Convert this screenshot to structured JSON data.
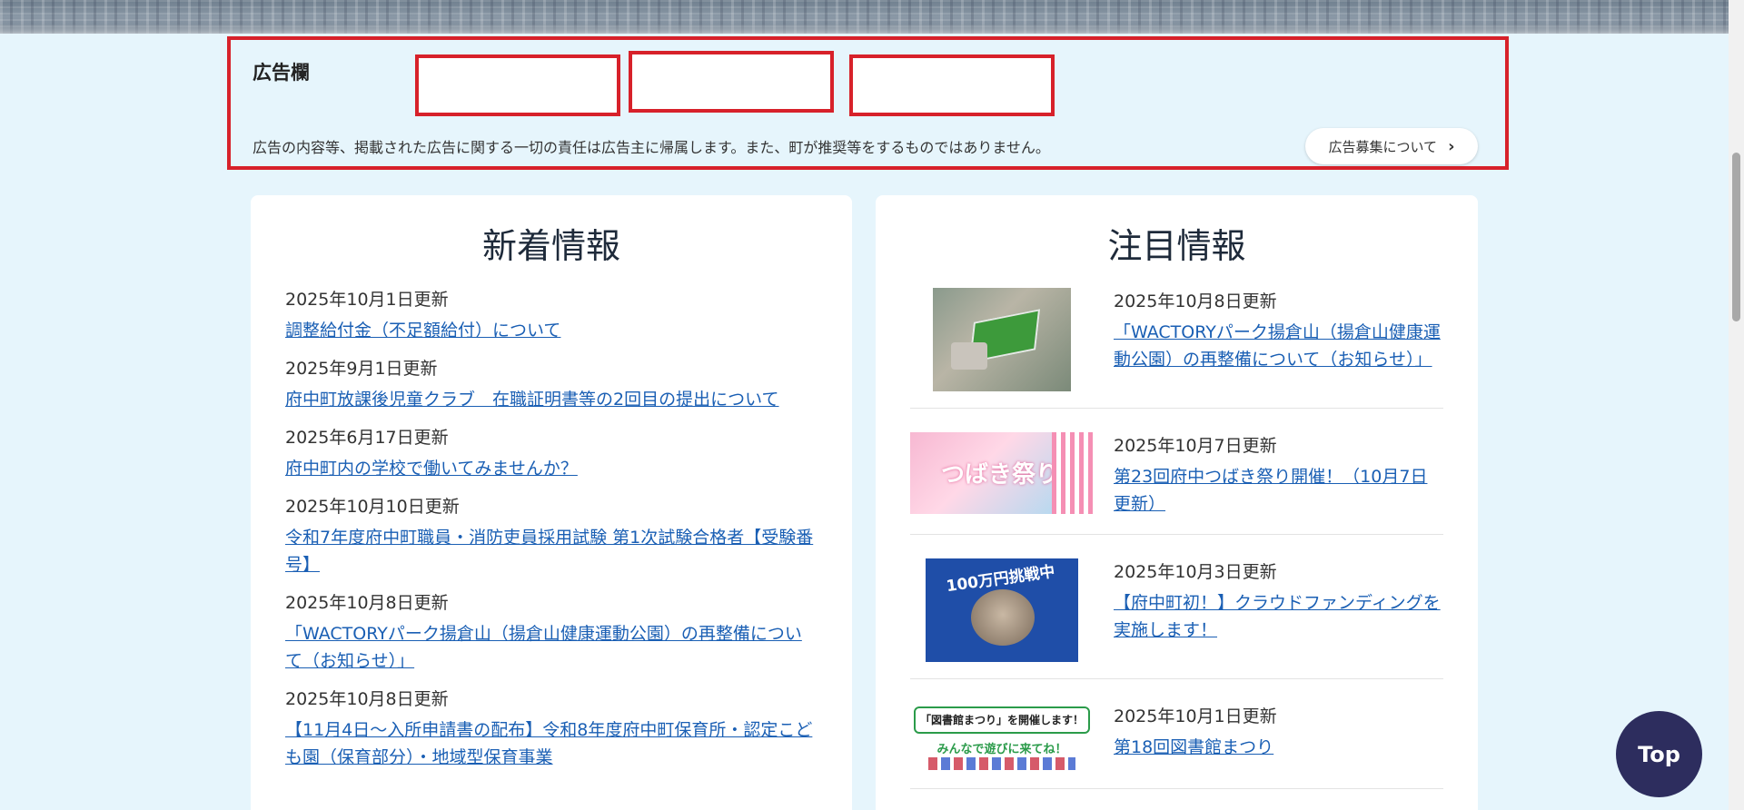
{
  "ad": {
    "title": "広告欄",
    "note": "広告の内容等、掲載された広告に関する一切の責任は広告主に帰属します。また、町が推奨等をするものではありません。",
    "more_label": "広告募集について",
    "chevron": "›"
  },
  "news": {
    "title": "新着情報",
    "items": [
      {
        "date": "2025年10月1日更新",
        "link": "調整給付金（不足額給付）について"
      },
      {
        "date": "2025年9月1日更新",
        "link": "府中町放課後児童クラブ　在職証明書等の2回目の提出について"
      },
      {
        "date": "2025年6月17日更新",
        "link": "府中町内の学校で働いてみませんか？"
      },
      {
        "date": "2025年10月10日更新",
        "link": "令和7年度府中町職員・消防吏員採用試験 第1次試験合格者【受験番号】"
      },
      {
        "date": "2025年10月8日更新",
        "link": "「WACTORYパーク揚倉山（揚倉山健康運動公園）の再整備について（お知らせ）」"
      },
      {
        "date": "2025年10月8日更新",
        "link": "【11月4日～入所申請書の配布】令和8年度府中町保育所・認定こども園（保育部分）・地域型保育事業"
      }
    ]
  },
  "feature": {
    "title": "注目情報",
    "items": [
      {
        "date": "2025年10月8日更新",
        "link": "「WACTORYパーク揚倉山（揚倉山健康運動公園）の再整備について（お知らせ）」"
      },
      {
        "date": "2025年10月7日更新",
        "link": "第23回府中つばき祭り開催！（10月7日更新）"
      },
      {
        "date": "2025年10月3日更新",
        "link": "【府中町初！】クラウドファンディングを実施します！"
      },
      {
        "date": "2025年10月1日更新",
        "link": "第18回図書館まつり"
      }
    ],
    "thumbs": {
      "fest_text": "つばき祭り",
      "cat_text": "100万円挑戦中",
      "lib_banner": "「図書館まつり」を開催します！",
      "lib_sub": "みんなで遊びに来てね！"
    }
  },
  "top_button": "Top"
}
